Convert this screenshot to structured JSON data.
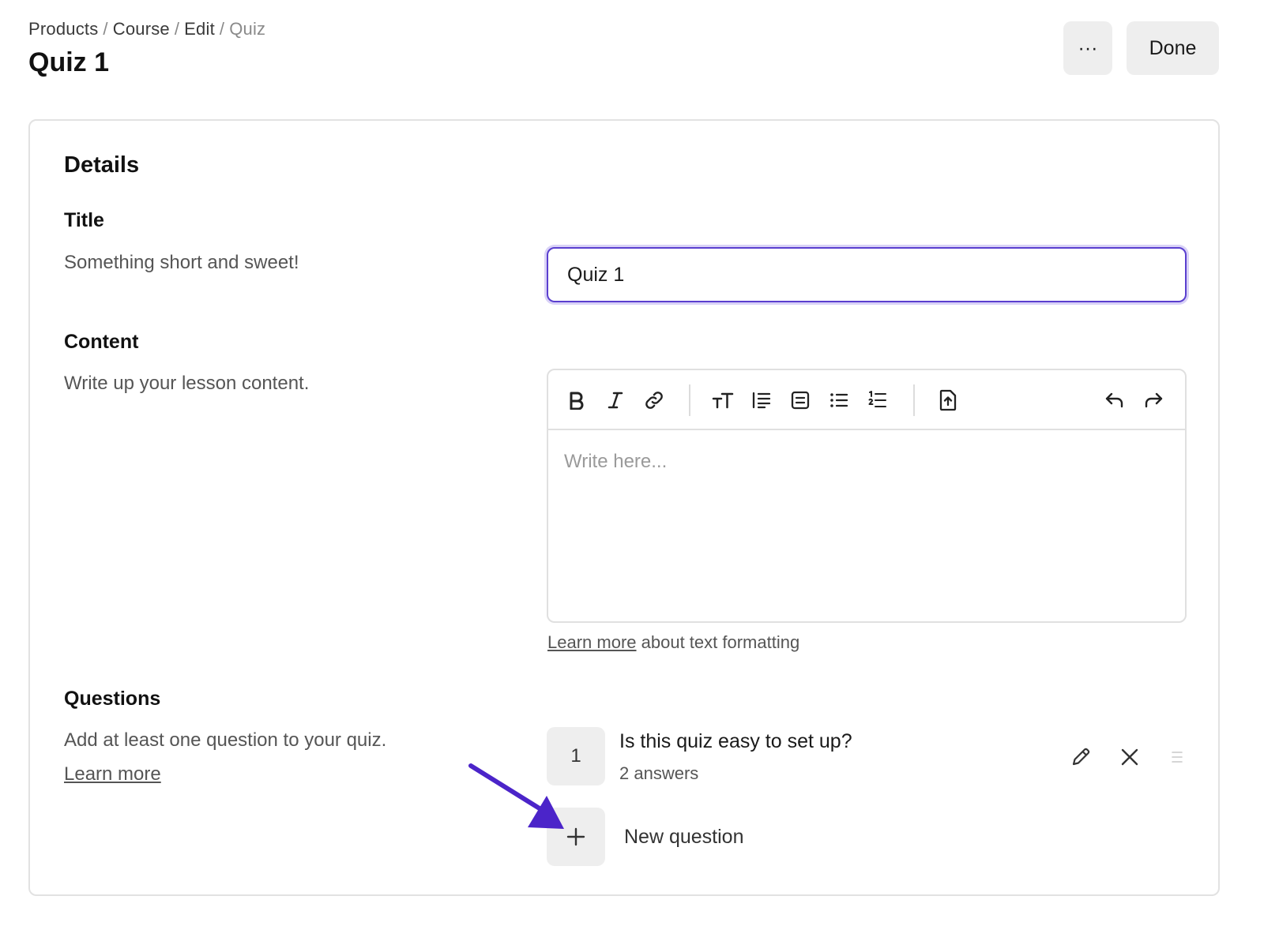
{
  "breadcrumb": {
    "items": [
      "Products",
      "Course",
      "Edit"
    ],
    "current": "Quiz",
    "separator": "/"
  },
  "page_title": "Quiz 1",
  "header": {
    "more_label": "···",
    "done_label": "Done"
  },
  "details": {
    "heading": "Details",
    "title_section": {
      "label": "Title",
      "description": "Something short and sweet!",
      "input_value": "Quiz 1"
    },
    "content_section": {
      "label": "Content",
      "description": "Write up your lesson content.",
      "editor_placeholder": "Write here...",
      "toolbar_icons": [
        "bold-icon",
        "italic-icon",
        "link-icon",
        "text-size-icon",
        "blockquote-icon",
        "embed-icon",
        "bullet-list-icon",
        "numbered-list-icon",
        "file-upload-icon",
        "undo-icon",
        "redo-icon"
      ],
      "help_link": "Learn more",
      "help_text": " about text formatting"
    },
    "questions_section": {
      "label": "Questions",
      "description": "Add at least one question to your quiz. ",
      "learn_more": "Learn more",
      "items": [
        {
          "number": "1",
          "text": "Is this quiz easy to set up?",
          "answers": "2 answers"
        }
      ],
      "new_question_label": "New question"
    }
  },
  "colors": {
    "accent": "#5a3fcf",
    "arrow": "#4b24c9",
    "button_bg": "#eeeeee",
    "border": "#e2e2e2"
  }
}
